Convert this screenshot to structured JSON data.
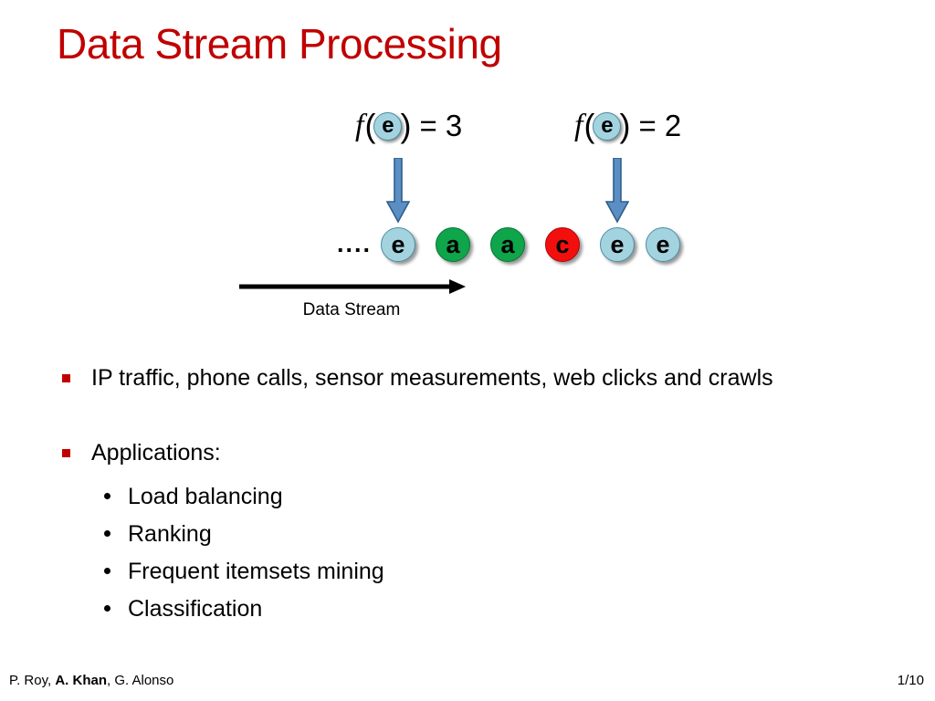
{
  "slide": {
    "title": "Data Stream Processing",
    "title_color": "#C00000",
    "background": "#ffffff"
  },
  "formulas": [
    {
      "fn": "f",
      "open": "(",
      "token": "e",
      "close": ")",
      "equals": "= 3"
    },
    {
      "fn": "f",
      "open": "(",
      "token": "e",
      "close": ")",
      "equals": "= 2"
    }
  ],
  "stream": {
    "leading_dots": "....",
    "tokens": [
      {
        "label": "e",
        "color": "blue"
      },
      {
        "label": "a",
        "color": "green"
      },
      {
        "label": "a",
        "color": "green"
      },
      {
        "label": "c",
        "color": "red"
      },
      {
        "label": "e",
        "color": "blue"
      },
      {
        "label": "e",
        "color": "blue"
      }
    ],
    "axis_label": "Data Stream",
    "arrow_color": "#000000",
    "pointer_color": "#4A7EBB"
  },
  "colors": {
    "token_blue": "#A4D3E0",
    "token_green": "#0FA54A",
    "token_red": "#F40F0F",
    "accent_red": "#C00000",
    "arrow_blue": "#4A7EBB"
  },
  "body": {
    "bullets": [
      {
        "text": "IP traffic, phone calls, sensor measurements, web clicks and crawls"
      },
      {
        "text": "Applications:"
      }
    ],
    "sub_bullets": [
      {
        "text": "Load balancing"
      },
      {
        "text": "Ranking"
      },
      {
        "text": "Frequent itemsets mining"
      },
      {
        "text": "Classification"
      }
    ]
  },
  "footer": {
    "author_1": "P. Roy, ",
    "author_2": "A. Khan",
    "author_3": ", G. Alonso",
    "page": "1/10"
  }
}
